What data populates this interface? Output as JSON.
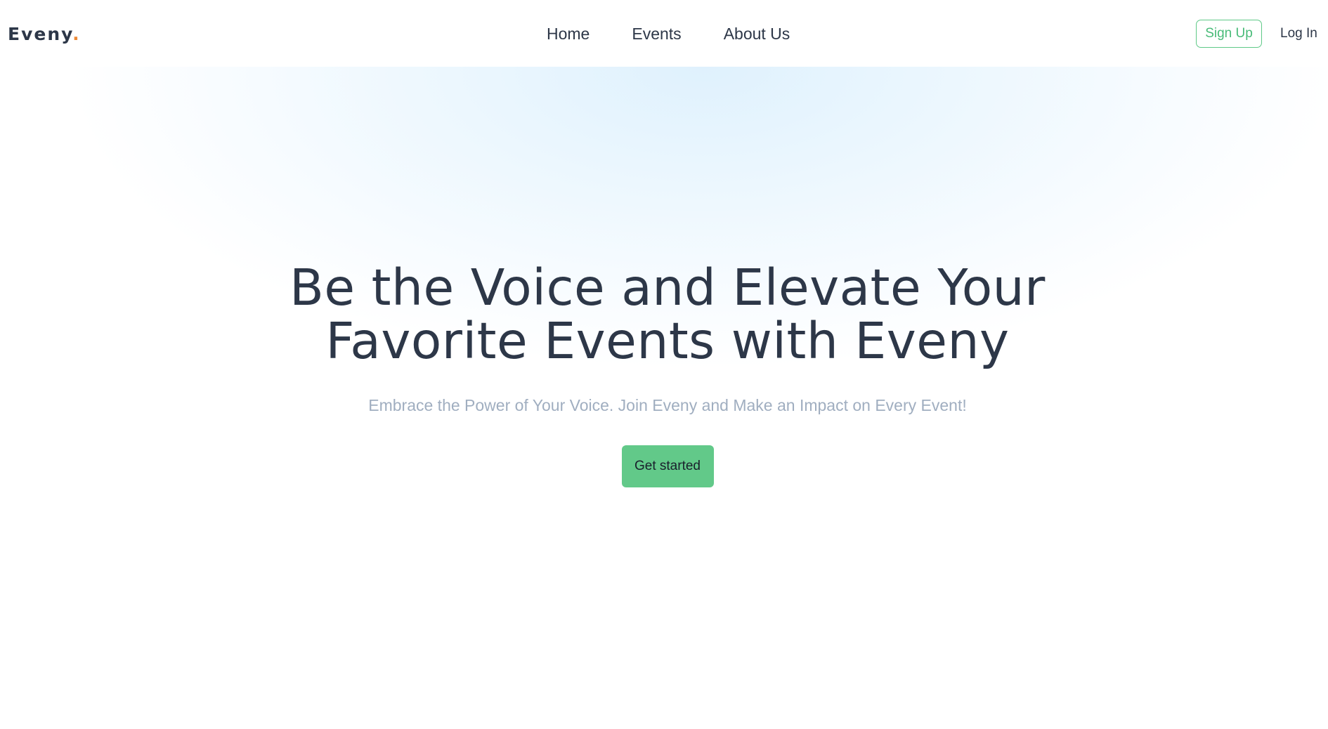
{
  "brand": {
    "name": "Eveny",
    "dot": "."
  },
  "nav": {
    "items": [
      {
        "label": "Home"
      },
      {
        "label": "Events"
      },
      {
        "label": "About Us"
      }
    ]
  },
  "auth": {
    "signup_label": "Sign Up",
    "login_label": "Log In"
  },
  "hero": {
    "title_line1": "Be the Voice and Elevate Your",
    "title_line2": "Favorite Events with Eveny",
    "subtitle": "Embrace the Power of Your Voice. Join Eveny and Make an Impact on Every Event!",
    "cta_label": "Get started"
  },
  "colors": {
    "text": "#2d3748",
    "accent_green": "#62c989",
    "logo_dot": "#ed8936",
    "subtitle": "#a0aec0",
    "glow": "#dff1fd"
  }
}
